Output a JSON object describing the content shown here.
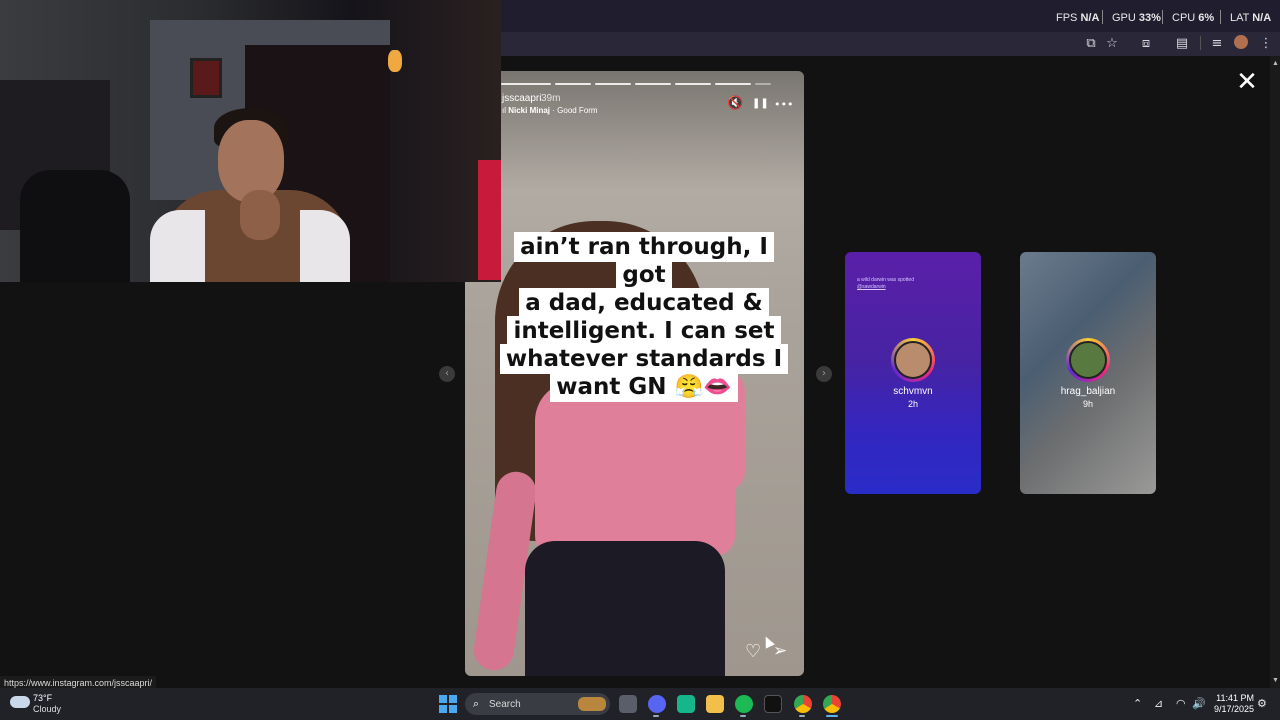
{
  "perf": {
    "fps_label": "FPS",
    "fps_value": "N/A",
    "gpu_label": "GPU",
    "gpu_value": "33",
    "cpu_label": "CPU",
    "cpu_value": "6",
    "lat_label": "LAT",
    "lat_value": "N/A",
    "percent": "%"
  },
  "browser": {
    "toolbar_icons": [
      "install-app-icon",
      "bookmark-star-icon",
      "extensions-icon",
      "side-panel-icon",
      "media-controls-icon",
      "profile-avatar",
      "menu-icon"
    ],
    "status_url": "https://www.instagram.com/jsscaapri/"
  },
  "story": {
    "username": "jsscaapri",
    "time": "39m",
    "music_artist": "Nicki Minaj",
    "music_separator": " · ",
    "music_track": "Good Form",
    "progress_segments": 7,
    "caption_lines": [
      "ain’t ran through, I got",
      "a dad, educated &",
      "intelligent. I can set",
      "whatever standards I",
      "want GN 😤👄"
    ],
    "icons": {
      "mute": "🔇",
      "pause": "❚❚",
      "more": "•••",
      "like": "♡",
      "send": "⊲"
    }
  },
  "previews": [
    {
      "username": "schvmvn",
      "time": "2h",
      "small_text": "a wild darwin was spotted",
      "small_tag": "@sawdarwin"
    },
    {
      "username": "hrag_baljian",
      "time": "9h"
    }
  ],
  "nav": {
    "prev": "‹",
    "next": "›",
    "close": "✕"
  },
  "taskbar": {
    "weather_temp": "73°F",
    "weather_condition": "Cloudy",
    "search_placeholder": "Search",
    "time": "11:41 PM",
    "date": "9/17/2025",
    "apps": [
      "task-view",
      "discord",
      "app-green",
      "file-explorer",
      "spotify",
      "obs",
      "chrome",
      "chrome-active"
    ]
  },
  "colors": {
    "accent_instagram": "#ee2a7b",
    "story_top": "#e07f9a",
    "preview1": "#4723a3",
    "taskbar": "#202228"
  }
}
